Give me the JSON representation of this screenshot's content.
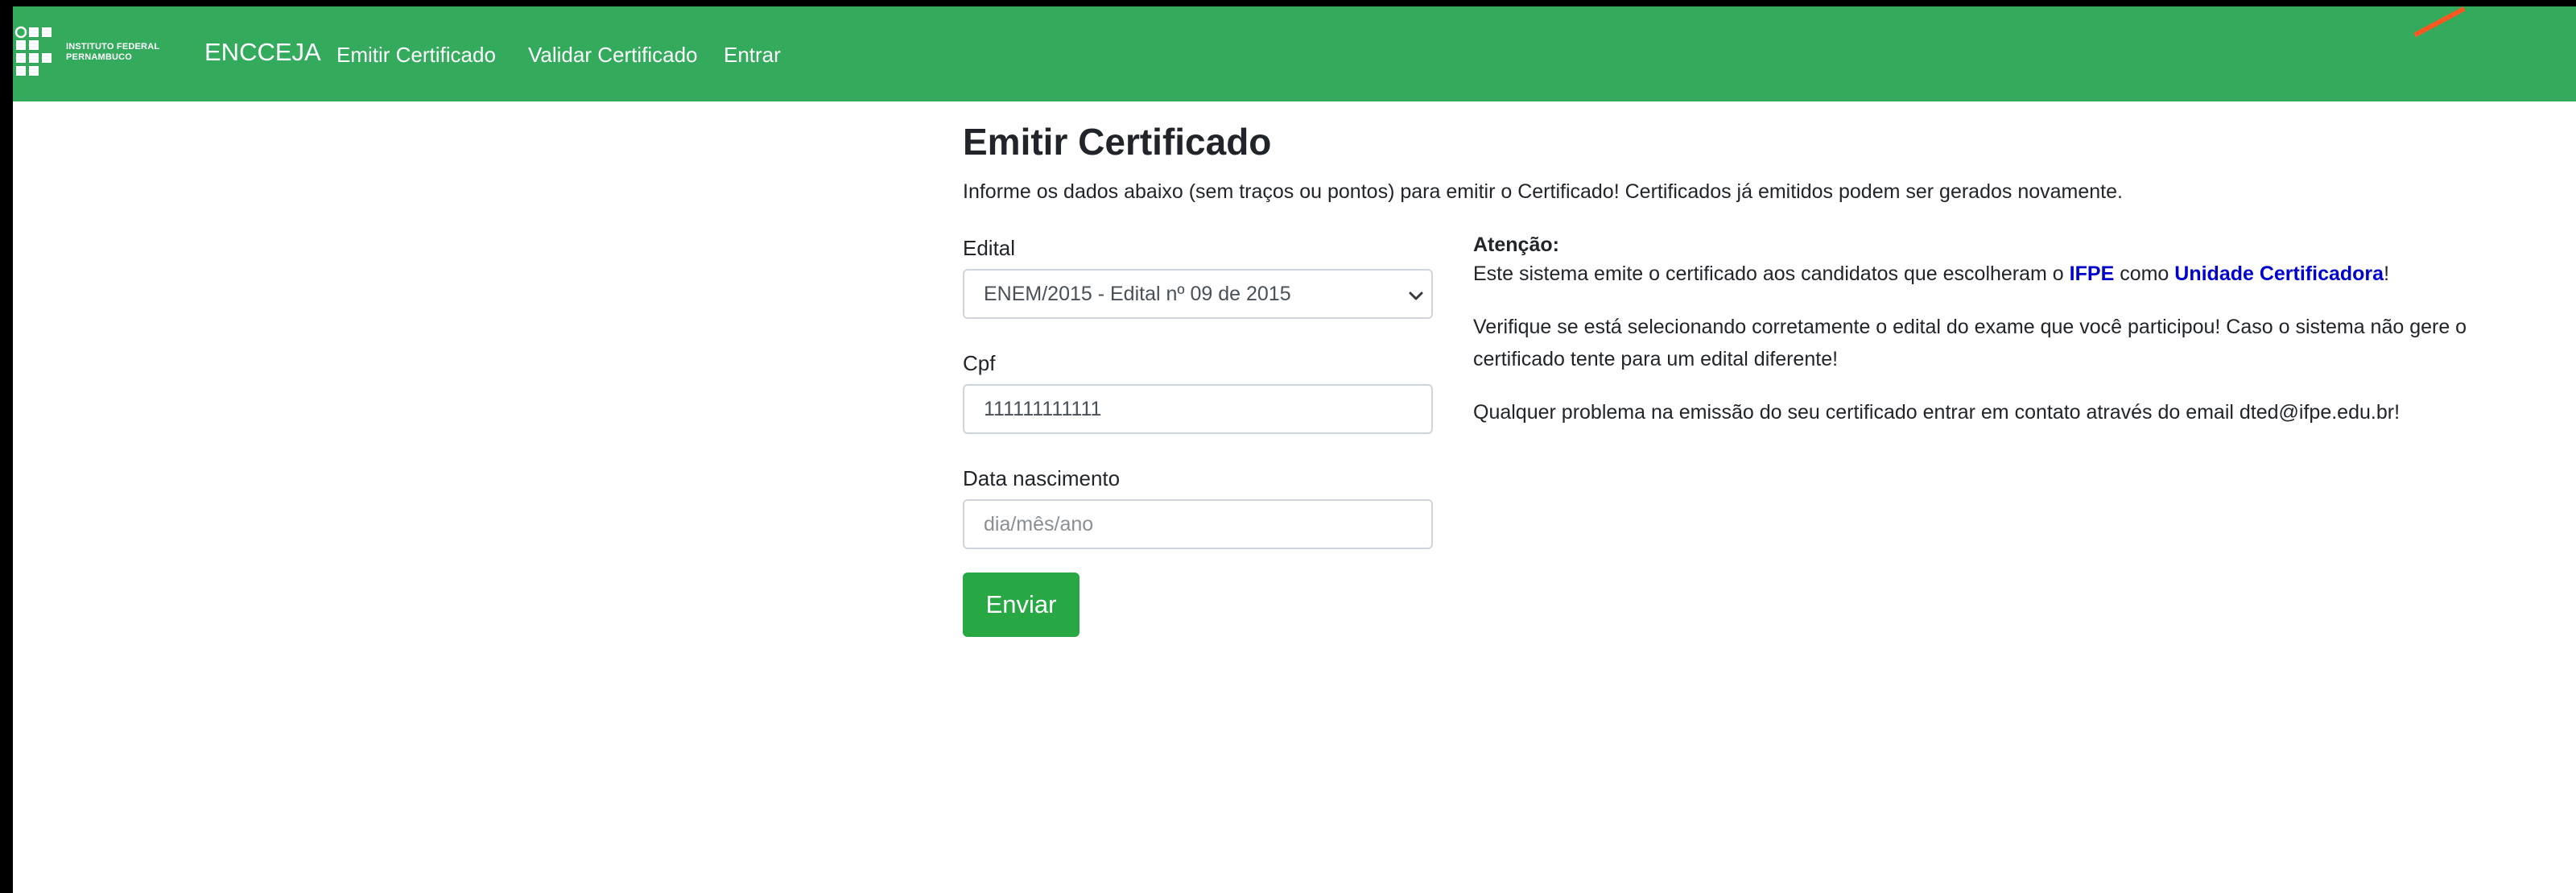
{
  "navbar": {
    "logo_line1": "INSTITUTO FEDERAL",
    "logo_line2": "PERNAMBUCO",
    "brand": "ENCCEJA",
    "links": [
      "Emitir Certificado",
      "Validar Certificado",
      "Entrar"
    ],
    "bg_color": "#33aa5c"
  },
  "page": {
    "title": "Emitir Certificado",
    "subtitle": "Informe os dados abaixo (sem traços ou pontos) para emitir o Certificado! Certificados já emitidos podem ser gerados novamente."
  },
  "form": {
    "edital_label": "Edital",
    "edital_selected": "ENEM/2015 - Edital nº 09 de 2015",
    "cpf_label": "Cpf",
    "cpf_value": "111111111111",
    "nascimento_label": "Data nascimento",
    "nascimento_placeholder": "dia/mês/ano",
    "submit_label": "Enviar"
  },
  "attention": {
    "title": "Atenção:",
    "p1_before": "Este sistema emite o certificado aos candidatos que escolheram o ",
    "p1_ifpe": "IFPE",
    "p1_middle": " como ",
    "p1_unidade": "Unidade Certificadora",
    "p1_after": "!",
    "p2": "Verifique se está selecionando corretamente o edital do exame que você participou! Caso o sistema não gere o certificado tente para um edital diferente!",
    "p3": "Qualquer problema na emissão do seu certificado entrar em contato através do email dted@ifpe.edu.br!"
  }
}
